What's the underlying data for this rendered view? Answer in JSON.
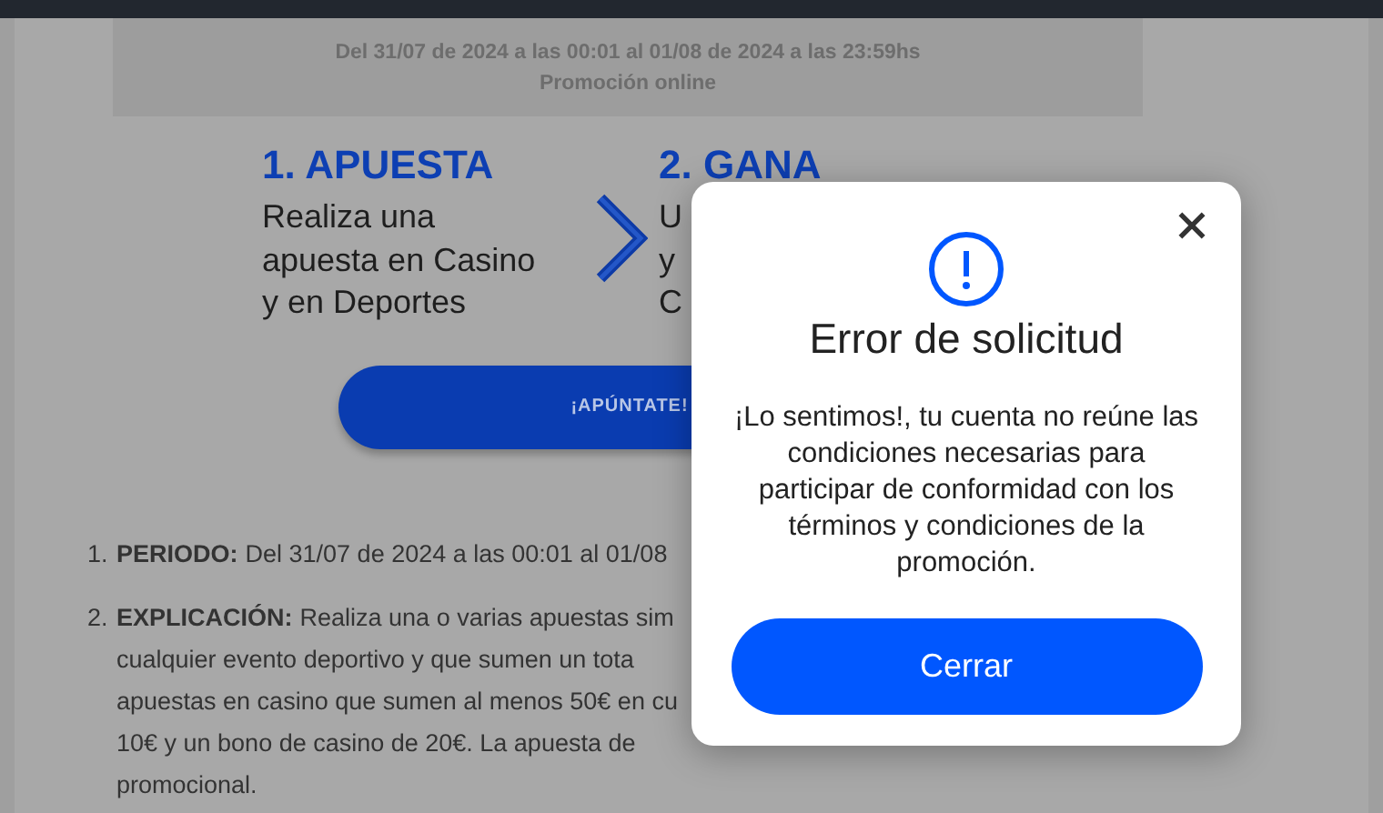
{
  "promo_box": {
    "lines": [
      "Del 31/07 de 2024 a las 00:01 al 01/08 de 2024 a las 23:59hs",
      "Promoción online"
    ]
  },
  "steps": [
    {
      "title": "1. APUESTA",
      "lines": [
        "Realiza una",
        "apuesta en Casino",
        "y en Deportes"
      ]
    },
    {
      "title": "2. GANA",
      "lines": [
        "U",
        "y",
        "C"
      ]
    }
  ],
  "cta_button": {
    "label": "¡APÚNTATE!"
  },
  "terms": [
    {
      "number": "1.",
      "label": "PERIODO:",
      "lines": [
        "Del 31/07 de 2024 a las 00:01 al 01/08"
      ]
    },
    {
      "number": "2.",
      "label": "EXPLICACIÓN:",
      "lines": [
        "Realiza una o varias apuestas sim",
        "cualquier evento deportivo y que sumen un tota",
        "apuestas en casino que sumen al menos 50€ en cu",
        "10€ y un bono de casino de 20€. La apuesta de",
        "promocional."
      ]
    }
  ],
  "modal": {
    "title": "Error de solicitud",
    "message": "¡Lo sentimos!, tu cuenta no reúne las condiciones necesarias para participar de conformidad con los términos y condiciones de la promoción.",
    "button": "Cerrar"
  }
}
